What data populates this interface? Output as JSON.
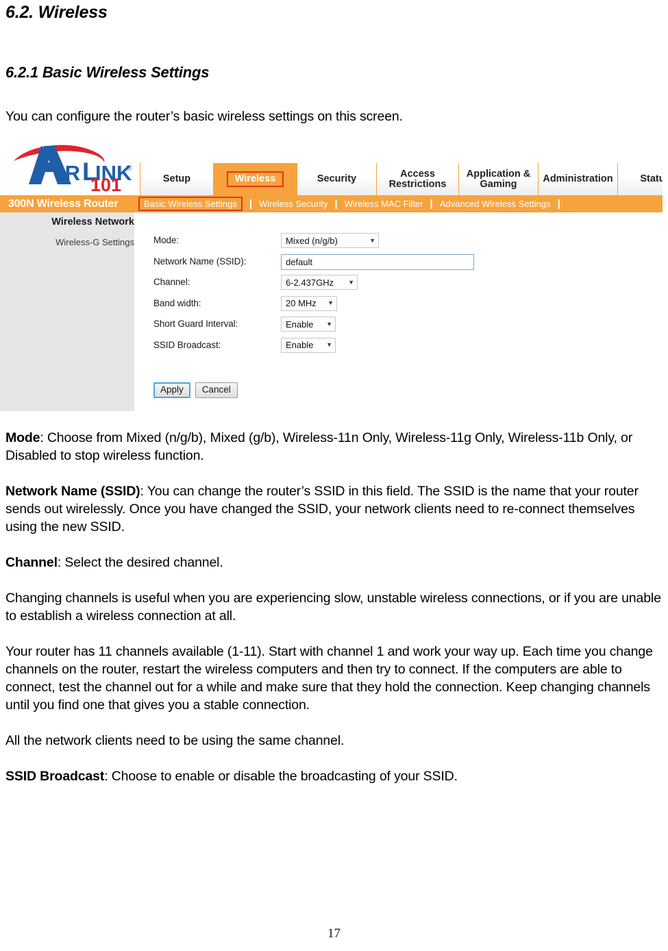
{
  "document": {
    "heading_1": "6.2. Wireless",
    "heading_2": "6.2.1 Basic Wireless Settings",
    "intro": "You can configure the router’s basic wireless settings on this screen.",
    "page_number": "17"
  },
  "screenshot": {
    "logo": {
      "brand": "AIRLINK",
      "brand_air": "A",
      "brand_ir": "IR",
      "brand_l": "L",
      "brand_ink": "INK",
      "registered": "®",
      "number": "101",
      "colors": {
        "blue": "#1f5fa9",
        "red": "#e0242c"
      }
    },
    "model_label": "300N Wireless Router",
    "tabs": [
      {
        "label": "Setup",
        "active": false
      },
      {
        "label": "Wireless",
        "active": true
      },
      {
        "label": "Security",
        "active": false
      },
      {
        "label": "Access Restrictions",
        "line1": "Access",
        "line2": "Restrictions",
        "active": false
      },
      {
        "label": "Application & Gaming",
        "line1": "Application &",
        "line2": "Gaming",
        "active": false
      },
      {
        "label": "Administration",
        "active": false
      },
      {
        "label": "Status",
        "active": false
      }
    ],
    "subtabs": [
      {
        "label": "Basic Wireless Settings",
        "active": true
      },
      {
        "label": "Wireless Security",
        "active": false
      },
      {
        "label": "Wireless MAC Filter",
        "active": false
      },
      {
        "label": "Advanced Wireless Settings",
        "active": false
      }
    ],
    "subtab_separator": "|",
    "sidebar": {
      "title": "Wireless Network",
      "subtitle": "Wireless-G Settings"
    },
    "form": {
      "fields": [
        {
          "label": "Mode:",
          "value": "Mixed (n/g/b)",
          "type": "select"
        },
        {
          "label": "Network Name (SSID):",
          "value": "default",
          "type": "text"
        },
        {
          "label": "Channel:",
          "value": "6-2.437GHz",
          "type": "select"
        },
        {
          "label": "Band width:",
          "value": "20 MHz",
          "type": "select"
        },
        {
          "label": "Short Guard Interval:",
          "value": "Enable",
          "type": "select"
        },
        {
          "label": "SSID Broadcast:",
          "value": "Enable",
          "type": "select"
        }
      ],
      "caret": "▼"
    },
    "buttons": {
      "apply": "Apply",
      "cancel": "Cancel"
    },
    "colors": {
      "orange": "#f6a33d",
      "highlight_red": "#e03a12",
      "sidebar_gray": "#e6e6e6"
    }
  },
  "descriptions": [
    {
      "term": "Mode",
      "rest": ": Choose from Mixed (n/g/b), Mixed (g/b), Wireless-11n Only, Wireless-11g Only, Wireless-11b Only, or Disabled to stop wireless function."
    },
    {
      "term": "Network Name (SSID)",
      "rest": ": You can change the router’s SSID in this field. The SSID is the name that your router sends out wirelessly.  Once you have changed the SSID, your network clients need to re-connect themselves using the new SSID."
    },
    {
      "term": "Channel",
      "rest": ": Select the desired channel."
    },
    {
      "term": "",
      "rest": "Changing channels is useful when you are experiencing slow, unstable wireless connections, or if you are unable to establish a wireless connection at all."
    },
    {
      "term": "",
      "rest": "Your router has 11 channels available (1-11).  Start with channel 1 and work your way up.  Each time you change channels on the router, restart the wireless computers and then try to connect.  If the computers are able to connect, test the channel out for a while and make sure that they hold the connection.  Keep changing channels until you find one that gives you a stable connection."
    },
    {
      "term": "",
      "rest": "All the network clients need to be using the same channel."
    },
    {
      "term": "SSID Broadcast",
      "rest": ": Choose to enable or disable the broadcasting of your SSID."
    }
  ]
}
